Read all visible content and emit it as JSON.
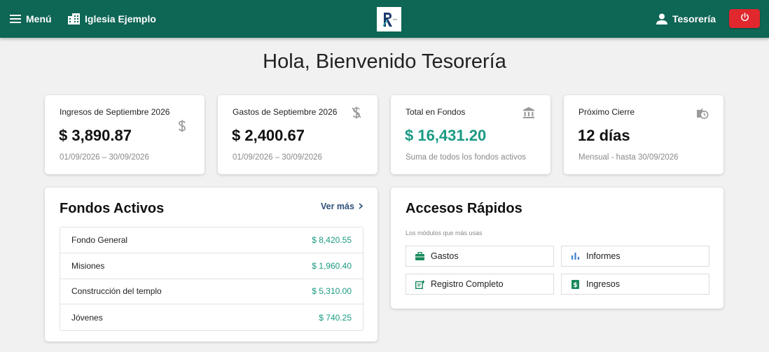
{
  "topbar": {
    "menu_label": "Menú",
    "church_name": "Iglesia Ejemplo",
    "logo_text": "R",
    "user_label": "Tesorería",
    "bg_color": "#0e6655",
    "logout_color": "#e0282e"
  },
  "greeting": "Hola, Bienvenido Tesorería",
  "stats": [
    {
      "title": "Ingresos de Septiembre 2026",
      "value": "$ 3,890.87",
      "subtitle": "01/09/2026 – 30/09/2026",
      "icon": "dollar-icon"
    },
    {
      "title": "Gastos de Septiembre 2026",
      "value": "$ 2,400.67",
      "subtitle": "01/09/2026 – 30/09/2026",
      "icon": "money-off-icon"
    },
    {
      "title": "Total en Fondos",
      "value": "$ 16,431.20",
      "subtitle": "Suma de todos los fondos activos",
      "icon": "bank-icon",
      "value_color": "#1a9a83"
    },
    {
      "title": "Próximo Cierre",
      "value": "12 días",
      "subtitle": "Mensual - hasta 30/09/2026",
      "icon": "clock-icon"
    }
  ],
  "funds": {
    "title": "Fondos Activos",
    "see_more": "Ver más",
    "items": [
      {
        "name": "Fondo General",
        "amount": "$ 8,420.55"
      },
      {
        "name": "Misiones",
        "amount": "$ 1,960.40"
      },
      {
        "name": "Construcción del templo",
        "amount": "$ 5,310.00"
      },
      {
        "name": "Jóvenes",
        "amount": "$ 740.25"
      }
    ]
  },
  "quick_access": {
    "title": "Accesos Rápidos",
    "subtitle": "Los módulos que más usas",
    "items": [
      {
        "label": "Gastos",
        "icon": "briefcase-icon"
      },
      {
        "label": "Informes",
        "icon": "bar-chart-icon"
      },
      {
        "label": "Registro Completo",
        "icon": "edit-note-icon"
      },
      {
        "label": "Ingresos",
        "icon": "money-icon"
      }
    ]
  },
  "colors": {
    "accent": "#0e6655",
    "positive": "#1a9a83",
    "link": "#2e4f7a"
  }
}
